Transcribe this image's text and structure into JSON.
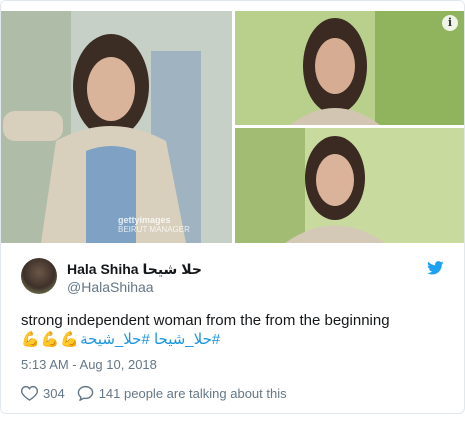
{
  "media": {
    "info_badge": "i",
    "watermark": {
      "brand": "gettyimages",
      "credit": "BEIRUT MANAGER"
    }
  },
  "tweet": {
    "display_name": "Hala Shiha حلا شيحا",
    "handle": "@HalaShihaa",
    "text_line1": "strong independent woman from the from the beginning",
    "emojis": [
      "💪",
      "💪",
      "💪"
    ],
    "hashtags": "#حلا_شيحا #حلا_شيحة",
    "timestamp": "5:13 AM - Aug 10, 2018",
    "likes": "304",
    "talking": "141 people are talking about this"
  },
  "colors": {
    "twitter_blue": "#1da1f2",
    "link": "#1b95e0",
    "meta_gray": "#657786",
    "text": "#14171a"
  },
  "icons": {
    "platform": "twitter-bird-icon",
    "like": "heart-icon",
    "reply": "speech-bubble-icon"
  }
}
